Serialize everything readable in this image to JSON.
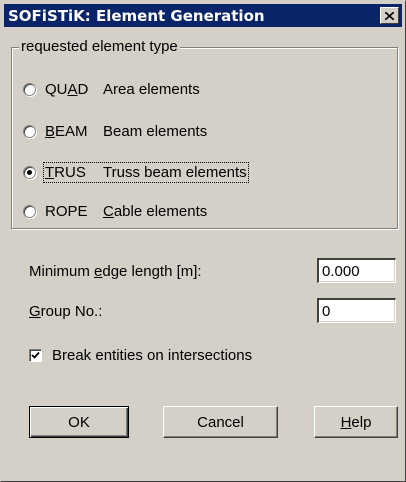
{
  "window": {
    "title": "SOFiSTiK: Element Generation",
    "close_label": "Close"
  },
  "element_type_group": {
    "label": "requested element type",
    "options": [
      {
        "code": "QUAD",
        "code_pre": "QU",
        "code_ul": "A",
        "code_post": "D",
        "desc_pre": "Area elements",
        "desc_ul": "",
        "desc_post": "",
        "checked": false
      },
      {
        "code": "BEAM",
        "code_pre": "",
        "code_ul": "B",
        "code_post": "EAM",
        "desc_pre": "Beam elements",
        "desc_ul": "",
        "desc_post": "",
        "checked": false
      },
      {
        "code": "TRUS",
        "code_pre": "",
        "code_ul": "T",
        "code_post": "RUS",
        "desc_pre": "Truss beam elements",
        "desc_ul": "",
        "desc_post": "",
        "checked": true
      },
      {
        "code": "ROPE",
        "code_pre": "ROPE",
        "code_ul": "",
        "code_post": "",
        "desc_pre": "",
        "desc_ul": "C",
        "desc_post": "able elements",
        "checked": false
      }
    ]
  },
  "min_edge": {
    "label_pre": "Minimum ",
    "label_ul": "e",
    "label_post": "dge length [m]:",
    "value": "0.000"
  },
  "group_no": {
    "label_ul": "G",
    "label_post": "roup No.:",
    "value": "0"
  },
  "break_entities": {
    "label": "Break entities on intersections",
    "checked": true
  },
  "buttons": {
    "ok": "OK",
    "cancel": "Cancel",
    "help_ul": "H",
    "help_post": "elp"
  },
  "colors": {
    "titlebar": "#0a246a",
    "dialog_face": "#d4d0c8"
  }
}
